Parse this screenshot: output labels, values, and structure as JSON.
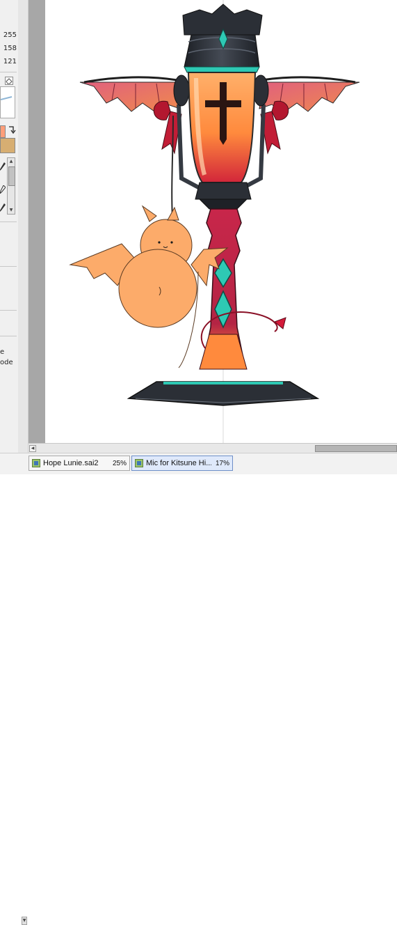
{
  "color_panel": {
    "r": "255",
    "g": "158",
    "b": "121",
    "main_color": "#ff9e79",
    "sub_color": "#d7ae72"
  },
  "tool_labels": [
    "e",
    "ode"
  ],
  "document_tabs": [
    {
      "name": "Hope Lunie.sai2",
      "zoom": "25%",
      "active": false
    },
    {
      "name": "Mic for Kitsune Hi...",
      "zoom": "17%",
      "active": true
    }
  ],
  "canvas": {
    "subject": "gothic microphone with bat wings, cross and a round orange bat creature",
    "colors": {
      "orange": "#ff9e62",
      "crimson": "#c8264a",
      "dark_metal": "#2b2f36",
      "teal": "#2ec9b4",
      "wing_pink": "#d84a6a",
      "mascot": "#fcab6a"
    }
  },
  "icons": {
    "swap": "swap-arrows-icon",
    "eraser": "eraser-icon",
    "pen": "pen-tool-icon",
    "brush": "brush-tool-icon",
    "doc": "sai-document-icon"
  }
}
